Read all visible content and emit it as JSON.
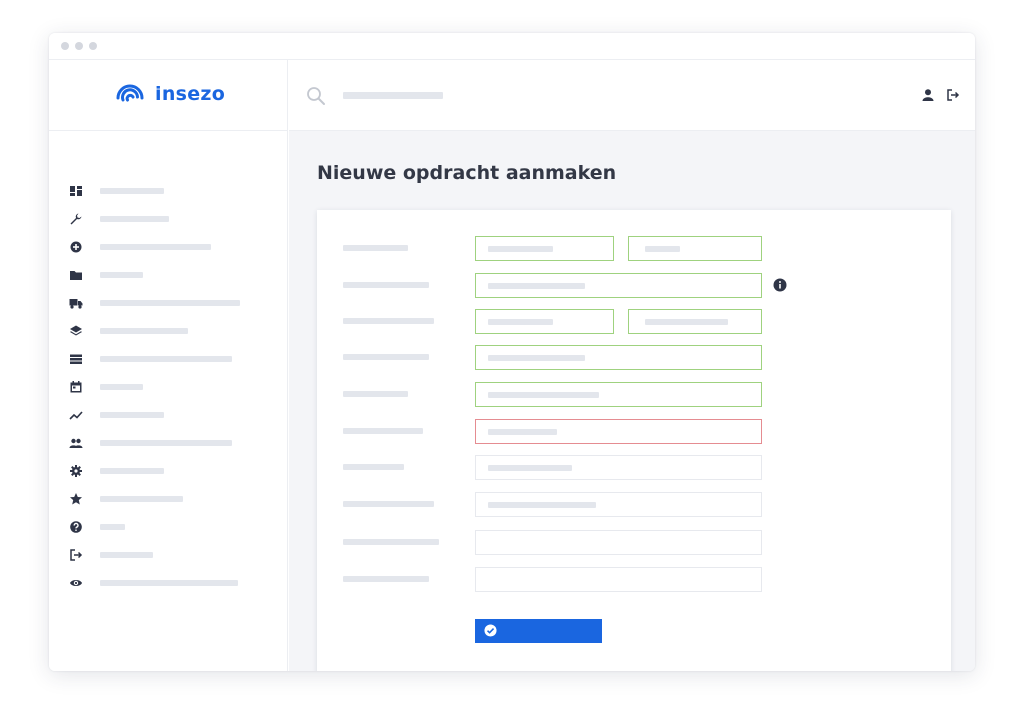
{
  "app": {
    "brand": "insezo",
    "brand_color": "#1a66e0"
  },
  "page": {
    "title": "Nieuwe opdracht aanmaken"
  },
  "sidebar": {
    "icons": [
      "dashboard-icon",
      "wrench-icon",
      "plus-circle-icon",
      "folder-icon",
      "truck-icon",
      "layers-icon",
      "list-icon",
      "calendar-icon",
      "chart-line-icon",
      "users-icon",
      "gear-icon",
      "star-icon",
      "help-icon",
      "logout-icon",
      "eye-icon"
    ]
  },
  "topbar": {
    "icons": [
      "search-icon",
      "user-icon",
      "logout-icon"
    ]
  },
  "form": {
    "field_states": [
      "valid",
      "valid",
      "valid",
      "valid",
      "valid",
      "valid",
      "valid",
      "invalid",
      "empty",
      "empty"
    ],
    "state_colors": {
      "valid": "#9fd27f",
      "invalid": "#e58c91",
      "empty": "#e7e9ee"
    },
    "submit_icon": "check-circle-icon"
  }
}
